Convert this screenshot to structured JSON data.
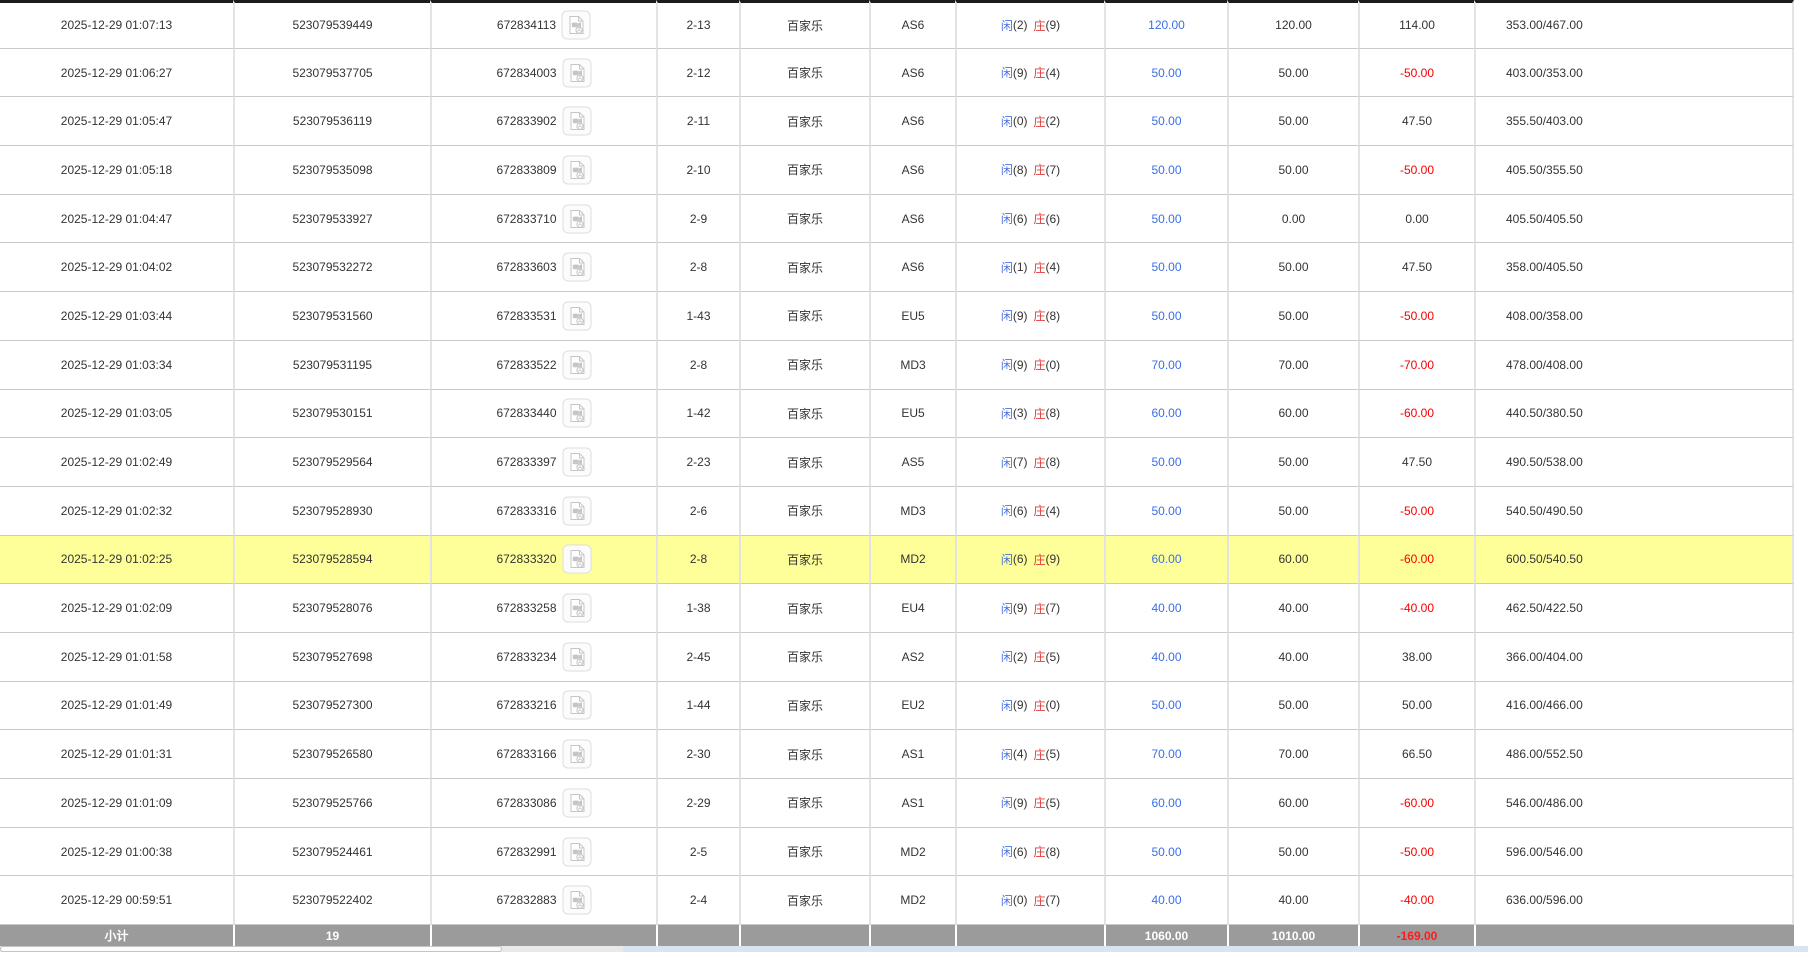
{
  "labels": {
    "player": "闲",
    "banker": "庄",
    "game": "百家乐"
  },
  "colors": {
    "player_blue": "#4a71e0",
    "banker_red": "#e03c3c",
    "bet_blue": "#3a6fe8",
    "negative_red": "#f50000",
    "highlight_yellow": "#ffff99",
    "subtotal_bg": "#9b9b9b",
    "top_border": "#1c1c1c"
  },
  "icons": {
    "video": "video-file-icon"
  },
  "table": {
    "rows": [
      {
        "time": "2025-12-29 01:07:13",
        "bet_id": "523079539449",
        "video_no": "672834113",
        "round": "2-13",
        "game": "百家乐",
        "table_code": "AS6",
        "p_score": "(2)",
        "b_score": "(9)",
        "bet": "120.00",
        "valid": "120.00",
        "winloss": "114.00",
        "balance": "353.00/467.00",
        "highlighted": false
      },
      {
        "time": "2025-12-29 01:06:27",
        "bet_id": "523079537705",
        "video_no": "672834003",
        "round": "2-12",
        "game": "百家乐",
        "table_code": "AS6",
        "p_score": "(9)",
        "b_score": "(4)",
        "bet": "50.00",
        "valid": "50.00",
        "winloss": "-50.00",
        "balance": "403.00/353.00",
        "highlighted": false
      },
      {
        "time": "2025-12-29 01:05:47",
        "bet_id": "523079536119",
        "video_no": "672833902",
        "round": "2-11",
        "game": "百家乐",
        "table_code": "AS6",
        "p_score": "(0)",
        "b_score": "(2)",
        "bet": "50.00",
        "valid": "50.00",
        "winloss": "47.50",
        "balance": "355.50/403.00",
        "highlighted": false
      },
      {
        "time": "2025-12-29 01:05:18",
        "bet_id": "523079535098",
        "video_no": "672833809",
        "round": "2-10",
        "game": "百家乐",
        "table_code": "AS6",
        "p_score": "(8)",
        "b_score": "(7)",
        "bet": "50.00",
        "valid": "50.00",
        "winloss": "-50.00",
        "balance": "405.50/355.50",
        "highlighted": false
      },
      {
        "time": "2025-12-29 01:04:47",
        "bet_id": "523079533927",
        "video_no": "672833710",
        "round": "2-9",
        "game": "百家乐",
        "table_code": "AS6",
        "p_score": "(6)",
        "b_score": "(6)",
        "bet": "50.00",
        "valid": "0.00",
        "winloss": "0.00",
        "balance": "405.50/405.50",
        "highlighted": false
      },
      {
        "time": "2025-12-29 01:04:02",
        "bet_id": "523079532272",
        "video_no": "672833603",
        "round": "2-8",
        "game": "百家乐",
        "table_code": "AS6",
        "p_score": "(1)",
        "b_score": "(4)",
        "bet": "50.00",
        "valid": "50.00",
        "winloss": "47.50",
        "balance": "358.00/405.50",
        "highlighted": false
      },
      {
        "time": "2025-12-29 01:03:44",
        "bet_id": "523079531560",
        "video_no": "672833531",
        "round": "1-43",
        "game": "百家乐",
        "table_code": "EU5",
        "p_score": "(9)",
        "b_score": "(8)",
        "bet": "50.00",
        "valid": "50.00",
        "winloss": "-50.00",
        "balance": "408.00/358.00",
        "highlighted": false
      },
      {
        "time": "2025-12-29 01:03:34",
        "bet_id": "523079531195",
        "video_no": "672833522",
        "round": "2-8",
        "game": "百家乐",
        "table_code": "MD3",
        "p_score": "(9)",
        "b_score": "(0)",
        "bet": "70.00",
        "valid": "70.00",
        "winloss": "-70.00",
        "balance": "478.00/408.00",
        "highlighted": false
      },
      {
        "time": "2025-12-29 01:03:05",
        "bet_id": "523079530151",
        "video_no": "672833440",
        "round": "1-42",
        "game": "百家乐",
        "table_code": "EU5",
        "p_score": "(3)",
        "b_score": "(8)",
        "bet": "60.00",
        "valid": "60.00",
        "winloss": "-60.00",
        "balance": "440.50/380.50",
        "highlighted": false
      },
      {
        "time": "2025-12-29 01:02:49",
        "bet_id": "523079529564",
        "video_no": "672833397",
        "round": "2-23",
        "game": "百家乐",
        "table_code": "AS5",
        "p_score": "(7)",
        "b_score": "(8)",
        "bet": "50.00",
        "valid": "50.00",
        "winloss": "47.50",
        "balance": "490.50/538.00",
        "highlighted": false
      },
      {
        "time": "2025-12-29 01:02:32",
        "bet_id": "523079528930",
        "video_no": "672833316",
        "round": "2-6",
        "game": "百家乐",
        "table_code": "MD3",
        "p_score": "(6)",
        "b_score": "(4)",
        "bet": "50.00",
        "valid": "50.00",
        "winloss": "-50.00",
        "balance": "540.50/490.50",
        "highlighted": false
      },
      {
        "time": "2025-12-29 01:02:25",
        "bet_id": "523079528594",
        "video_no": "672833320",
        "round": "2-8",
        "game": "百家乐",
        "table_code": "MD2",
        "p_score": "(6)",
        "b_score": "(9)",
        "bet": "60.00",
        "valid": "60.00",
        "winloss": "-60.00",
        "balance": "600.50/540.50",
        "highlighted": true
      },
      {
        "time": "2025-12-29 01:02:09",
        "bet_id": "523079528076",
        "video_no": "672833258",
        "round": "1-38",
        "game": "百家乐",
        "table_code": "EU4",
        "p_score": "(9)",
        "b_score": "(7)",
        "bet": "40.00",
        "valid": "40.00",
        "winloss": "-40.00",
        "balance": "462.50/422.50",
        "highlighted": false
      },
      {
        "time": "2025-12-29 01:01:58",
        "bet_id": "523079527698",
        "video_no": "672833234",
        "round": "2-45",
        "game": "百家乐",
        "table_code": "AS2",
        "p_score": "(2)",
        "b_score": "(5)",
        "bet": "40.00",
        "valid": "40.00",
        "winloss": "38.00",
        "balance": "366.00/404.00",
        "highlighted": false
      },
      {
        "time": "2025-12-29 01:01:49",
        "bet_id": "523079527300",
        "video_no": "672833216",
        "round": "1-44",
        "game": "百家乐",
        "table_code": "EU2",
        "p_score": "(9)",
        "b_score": "(0)",
        "bet": "50.00",
        "valid": "50.00",
        "winloss": "50.00",
        "balance": "416.00/466.00",
        "highlighted": false
      },
      {
        "time": "2025-12-29 01:01:31",
        "bet_id": "523079526580",
        "video_no": "672833166",
        "round": "2-30",
        "game": "百家乐",
        "table_code": "AS1",
        "p_score": "(4)",
        "b_score": "(5)",
        "bet": "70.00",
        "valid": "70.00",
        "winloss": "66.50",
        "balance": "486.00/552.50",
        "highlighted": false
      },
      {
        "time": "2025-12-29 01:01:09",
        "bet_id": "523079525766",
        "video_no": "672833086",
        "round": "2-29",
        "game": "百家乐",
        "table_code": "AS1",
        "p_score": "(9)",
        "b_score": "(5)",
        "bet": "60.00",
        "valid": "60.00",
        "winloss": "-60.00",
        "balance": "546.00/486.00",
        "highlighted": false
      },
      {
        "time": "2025-12-29 01:00:38",
        "bet_id": "523079524461",
        "video_no": "672832991",
        "round": "2-5",
        "game": "百家乐",
        "table_code": "MD2",
        "p_score": "(6)",
        "b_score": "(8)",
        "bet": "50.00",
        "valid": "50.00",
        "winloss": "-50.00",
        "balance": "596.00/546.00",
        "highlighted": false
      },
      {
        "time": "2025-12-29 00:59:51",
        "bet_id": "523079522402",
        "video_no": "672832883",
        "round": "2-4",
        "game": "百家乐",
        "table_code": "MD2",
        "p_score": "(0)",
        "b_score": "(7)",
        "bet": "40.00",
        "valid": "40.00",
        "winloss": "-40.00",
        "balance": "636.00/596.00",
        "highlighted": false
      }
    ]
  },
  "subtotal": {
    "label": "小计",
    "count": "19",
    "bet_total": "1060.00",
    "valid_total": "1010.00",
    "winloss_total": "-169.00"
  }
}
